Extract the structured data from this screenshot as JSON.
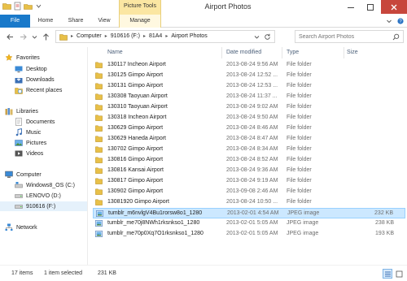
{
  "window": {
    "title": "Airport Photos",
    "context_tab_group": "Picture Tools",
    "accent_color": "#1979ca",
    "context_color": "#fbe6a2"
  },
  "ribbon": {
    "tabs": {
      "file": "File",
      "home": "Home",
      "share": "Share",
      "view": "View",
      "manage": "Manage"
    }
  },
  "address": {
    "crumbs": [
      "Computer",
      "910616 (F:)",
      "81A4",
      "Airport Photos"
    ],
    "search_placeholder": "Search Airport Photos"
  },
  "nav": {
    "favorites": "Favorites",
    "desktop": "Desktop",
    "downloads": "Downloads",
    "recent": "Recent places",
    "libraries": "Libraries",
    "documents": "Documents",
    "music": "Music",
    "pictures": "Pictures",
    "videos": "Videos",
    "computer": "Computer",
    "drive_c": "Windows8_OS (C:)",
    "drive_d": "LENOVO (D:)",
    "drive_f": "910616 (F:)",
    "network": "Network"
  },
  "columns": {
    "name": "Name",
    "date": "Date modified",
    "type": "Type",
    "size": "Size"
  },
  "files": [
    {
      "name": "130117 Incheon Airport",
      "date": "2013-08-24 9:56 AM",
      "type": "File folder",
      "size": "",
      "kind": "folder"
    },
    {
      "name": "130125 Gimpo Airport",
      "date": "2013-08-24 12:52 ...",
      "type": "File folder",
      "size": "",
      "kind": "folder"
    },
    {
      "name": "130131 Gimpo Airport",
      "date": "2013-08-24 12:53 ...",
      "type": "File folder",
      "size": "",
      "kind": "folder"
    },
    {
      "name": "130308 Taoyuan Airport",
      "date": "2013-08-24 11:37 ...",
      "type": "File folder",
      "size": "",
      "kind": "folder"
    },
    {
      "name": "130310 Taoyuan Airport",
      "date": "2013-08-24 9:02 AM",
      "type": "File folder",
      "size": "",
      "kind": "folder"
    },
    {
      "name": "130318 Incheon Airport",
      "date": "2013-08-24 9:50 AM",
      "type": "File folder",
      "size": "",
      "kind": "folder"
    },
    {
      "name": "130629 Gimpo Airport",
      "date": "2013-08-24 8:46 AM",
      "type": "File folder",
      "size": "",
      "kind": "folder"
    },
    {
      "name": "130629 Haneda Airport",
      "date": "2013-08-24 8:47 AM",
      "type": "File folder",
      "size": "",
      "kind": "folder"
    },
    {
      "name": "130702 Gimpo Airport",
      "date": "2013-08-24 8:34 AM",
      "type": "File folder",
      "size": "",
      "kind": "folder"
    },
    {
      "name": "130816 Gimpo Airport",
      "date": "2013-08-24 8:52 AM",
      "type": "File folder",
      "size": "",
      "kind": "folder"
    },
    {
      "name": "130816 Kansai Airport",
      "date": "2013-08-24 9:36 AM",
      "type": "File folder",
      "size": "",
      "kind": "folder"
    },
    {
      "name": "130817 Gimpo Airport",
      "date": "2013-08-24 9:19 AM",
      "type": "File folder",
      "size": "",
      "kind": "folder"
    },
    {
      "name": "130902 Gimpo Airport",
      "date": "2013-09-08 2:46 AM",
      "type": "File folder",
      "size": "",
      "kind": "folder"
    },
    {
      "name": "13081920 Gimpo Airport",
      "date": "2013-08-24 10:50 ...",
      "type": "File folder",
      "size": "",
      "kind": "folder"
    },
    {
      "name": "tumblr_m6nvlgV4Bu1rorsw8o1_1280",
      "date": "2013-02-01 4:54 AM",
      "type": "JPEG image",
      "size": "232 KB",
      "kind": "image",
      "selected": true
    },
    {
      "name": "tumblr_me70j8NWh1rksnkso1_1280",
      "date": "2013-02-01 5:05 AM",
      "type": "JPEG image",
      "size": "238 KB",
      "kind": "image"
    },
    {
      "name": "tumblr_me70p0Xq7O1rksnkso1_1280",
      "date": "2013-02-01 5:05 AM",
      "type": "JPEG image",
      "size": "193 KB",
      "kind": "image"
    }
  ],
  "status": {
    "count": "17 items",
    "selection": "1 item selected",
    "selected_size": "231 KB"
  }
}
